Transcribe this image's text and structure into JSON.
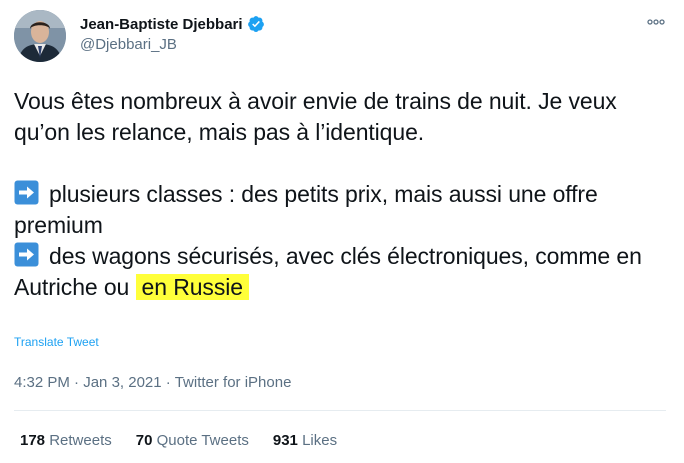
{
  "author": {
    "display_name": "Jean-Baptiste Djebbari",
    "handle": "@Djebbari_JB",
    "verified_icon": "verified-badge-icon",
    "avatar": "avatar-photo"
  },
  "menu_icon": "more-options-icon",
  "tweet": {
    "line1": "Vous êtes nombreux à avoir envie de trains de nuit. Je veux qu’on les relance, mais pas à l’identique.",
    "bullet1": "plusieurs classes : des petits prix, mais aussi une offre premium",
    "bullet2_prefix": "des wagons sécurisés, avec clés électroniques, comme en Autriche ou",
    "bullet2_highlight": "en Russie",
    "bullet_icon": "right-arrow-emoji-icon"
  },
  "translate_label": "Translate Tweet",
  "meta": {
    "time": "4:32 PM",
    "date": "Jan 3, 2021",
    "source": "Twitter for iPhone",
    "separator": "·"
  },
  "stats": {
    "retweets_count": "178",
    "retweets_label": "Retweets",
    "quotes_count": "70",
    "quotes_label": "Quote Tweets",
    "likes_count": "931",
    "likes_label": "Likes"
  },
  "colors": {
    "accent": "#1da1f2",
    "highlight": "#ffff3a",
    "secondary_text": "#5b7083"
  }
}
